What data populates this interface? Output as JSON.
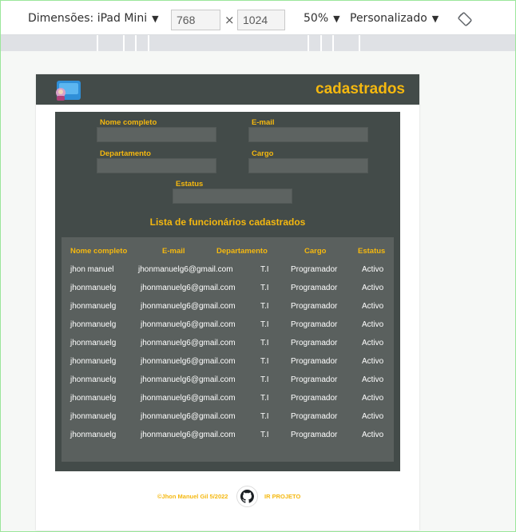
{
  "devtools": {
    "dimensions_label": "Dimensões: iPad Mini",
    "width_value": "768",
    "height_value": "1024",
    "times_sign": "×",
    "zoom_label": "50%",
    "throttle_label": "Personalizado",
    "caret": "▼"
  },
  "header": {
    "title": "cadastrados"
  },
  "form": {
    "name_label": "Nome completo",
    "email_label": "E-mail",
    "department_label": "Departamento",
    "role_label": "Cargo",
    "status_label": "Estatus",
    "name_value": "",
    "email_value": "",
    "department_value": "",
    "role_value": "",
    "status_value": ""
  },
  "list": {
    "title": "Lista de funcionários cadastrados",
    "columns": [
      "Nome completo",
      "E-mail",
      "Departamento",
      "Cargo",
      "Estatus"
    ],
    "rows": [
      [
        "jhon manuel",
        "jhonmanuelg6@gmail.com",
        "T.I",
        "Programador",
        "Activo"
      ],
      [
        "jhonmanuelg",
        "jhonmanuelg6@gmail.com",
        "T.I",
        "Programador",
        "Activo"
      ],
      [
        "jhonmanuelg",
        "jhonmanuelg6@gmail.com",
        "T.I",
        "Programador",
        "Activo"
      ],
      [
        "jhonmanuelg",
        "jhonmanuelg6@gmail.com",
        "T.I",
        "Programador",
        "Activo"
      ],
      [
        "jhonmanuelg",
        "jhonmanuelg6@gmail.com",
        "T.I",
        "Programador",
        "Activo"
      ],
      [
        "jhonmanuelg",
        "jhonmanuelg6@gmail.com",
        "T.I",
        "Programador",
        "Activo"
      ],
      [
        "jhonmanuelg",
        "jhonmanuelg6@gmail.com",
        "T.I",
        "Programador",
        "Activo"
      ],
      [
        "jhonmanuelg",
        "jhonmanuelg6@gmail.com",
        "T.I",
        "Programador",
        "Activo"
      ],
      [
        "jhonmanuelg",
        "jhonmanuelg6@gmail.com",
        "T.I",
        "Programador",
        "Activo"
      ],
      [
        "jhonmanuelg",
        "jhonmanuelg6@gmail.com",
        "T.I",
        "Programador",
        "Activo"
      ]
    ]
  },
  "footer": {
    "copyright": "©Jhon Manuel Gil 5/2022",
    "project_link": "IR PROJETO",
    "icon": "github-icon"
  },
  "colors": {
    "accent": "#f5b80f",
    "panel": "#434b49",
    "table_bg": "#5a605e"
  }
}
